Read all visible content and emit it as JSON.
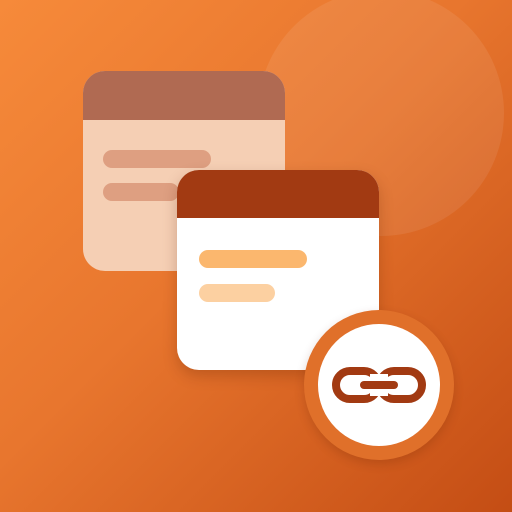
{
  "icon": {
    "name": "notes-link-app-icon",
    "colors": {
      "background_start": "#f68a3a",
      "background_end": "#c44d14",
      "front_card_header": "#a23a12",
      "back_card_header": "#b06a52",
      "back_card_body": "#f5cfb4",
      "front_line_primary": "#fbb76e",
      "front_line_secondary": "#fcd0a1",
      "link_glyph": "#a23a12"
    },
    "glyphs": [
      "note-card-icon",
      "note-card-icon",
      "link-icon"
    ]
  }
}
